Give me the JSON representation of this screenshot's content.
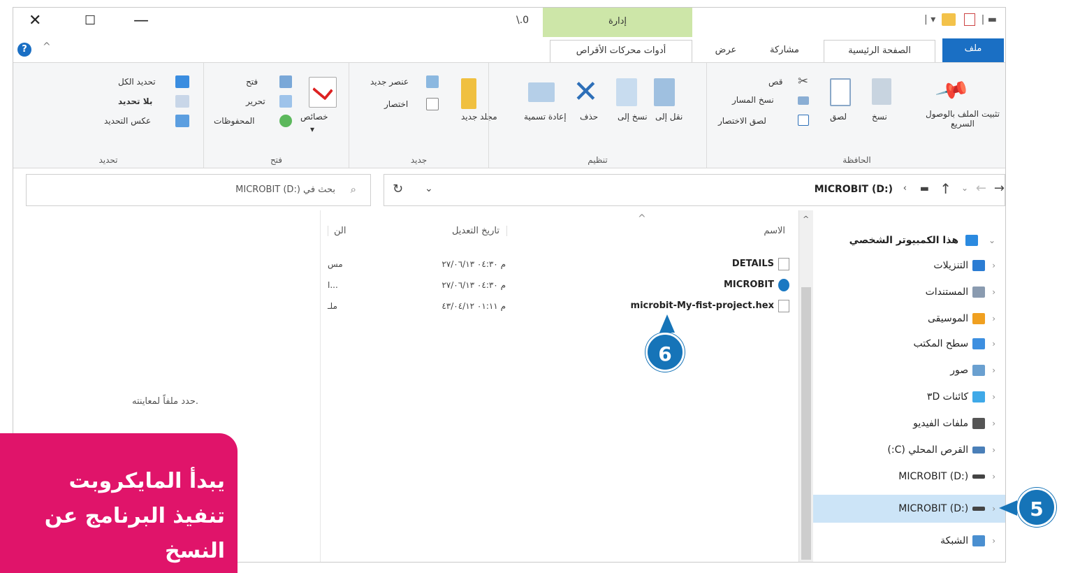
{
  "titlebar": {
    "version": "\\.0",
    "context_tab": "إدارة"
  },
  "tabs": {
    "file": "ملف",
    "home": "الصفحة الرئيسية",
    "share": "مشاركة",
    "view": "عرض",
    "drive_tools": "أدوات محركات الأقراص"
  },
  "ribbon": {
    "clipboard": {
      "label": "الحافظة",
      "pin": "تثبيت الملف بالوصول السريع",
      "copy": "نسخ",
      "paste": "لصق",
      "cut": "قص",
      "copy_path": "نسخ المسار",
      "paste_shortcut": "لصق الاختصار"
    },
    "organize": {
      "label": "تنظيم",
      "move_to": "نقل إلى",
      "copy_to": "نسخ إلى",
      "delete": "حذف",
      "rename": "إعادة تسمية"
    },
    "new": {
      "label": "جديد",
      "new_folder": "مجلد جديد",
      "new_item": "عنصر جديد",
      "easy_access": "اختصار"
    },
    "open": {
      "label": "فتح",
      "properties": "خصائص",
      "open": "فتح",
      "edit": "تحرير",
      "history": "المحفوظات"
    },
    "select": {
      "label": "تحديد",
      "select_all": "تحديد الكل",
      "select_none": "بلا تحديد",
      "invert": "عكس التحديد"
    }
  },
  "address": {
    "path": "MICROBIT (D:)",
    "search_placeholder": "بحث في MICROBIT (D:)"
  },
  "nav": {
    "this_pc": "هذا الكمبيوتر الشخصي",
    "items": [
      {
        "label": "التنزيلات",
        "color": "#2b7cd3"
      },
      {
        "label": "المستندات",
        "color": "#8a9bb0"
      },
      {
        "label": "الموسيقى",
        "color": "#f0a020"
      },
      {
        "label": "سطح المكتب",
        "color": "#3d8fe0"
      },
      {
        "label": "صور",
        "color": "#6aa0d0"
      },
      {
        "label": "كائنات ۳D",
        "color": "#3fa9e8"
      },
      {
        "label": "ملفات الفيديو",
        "color": "#555555"
      },
      {
        "label": "القرص المحلي (C:)",
        "color": "#4a7fb8"
      },
      {
        "label": "MICROBIT (D:)",
        "color": "#444444"
      },
      {
        "label": "MICROBIT (D:)",
        "color": "#444444"
      },
      {
        "label": "الشبكة",
        "color": "#4a8fd0"
      }
    ]
  },
  "files": {
    "headers": {
      "name": "الاسم",
      "date": "تاريخ التعديل",
      "type": "الن"
    },
    "rows": [
      {
        "name": "DETAILS",
        "date": "۲۷/۰٦/۱۳ م ۰٤:۳۰",
        "type": "مس"
      },
      {
        "name": "MICROBIT",
        "date": "۲۷/۰٦/۱۳ م ۰٤:۳۰",
        "type": "ا..."
      },
      {
        "name": "microbit-My-fist-project.hex",
        "date": "٤۳/۰٤/۱۲ م ۰۱:۱۱",
        "type": "ملـ"
      }
    ]
  },
  "preview": {
    "text": "حدد ملفاً لمعاينته."
  },
  "callouts": {
    "five": "5",
    "six": "6"
  },
  "note": {
    "line1": "يبدأ المايكروبت",
    "line2": "تنفيذ البرنامج عن",
    "line3": "النسخ"
  }
}
